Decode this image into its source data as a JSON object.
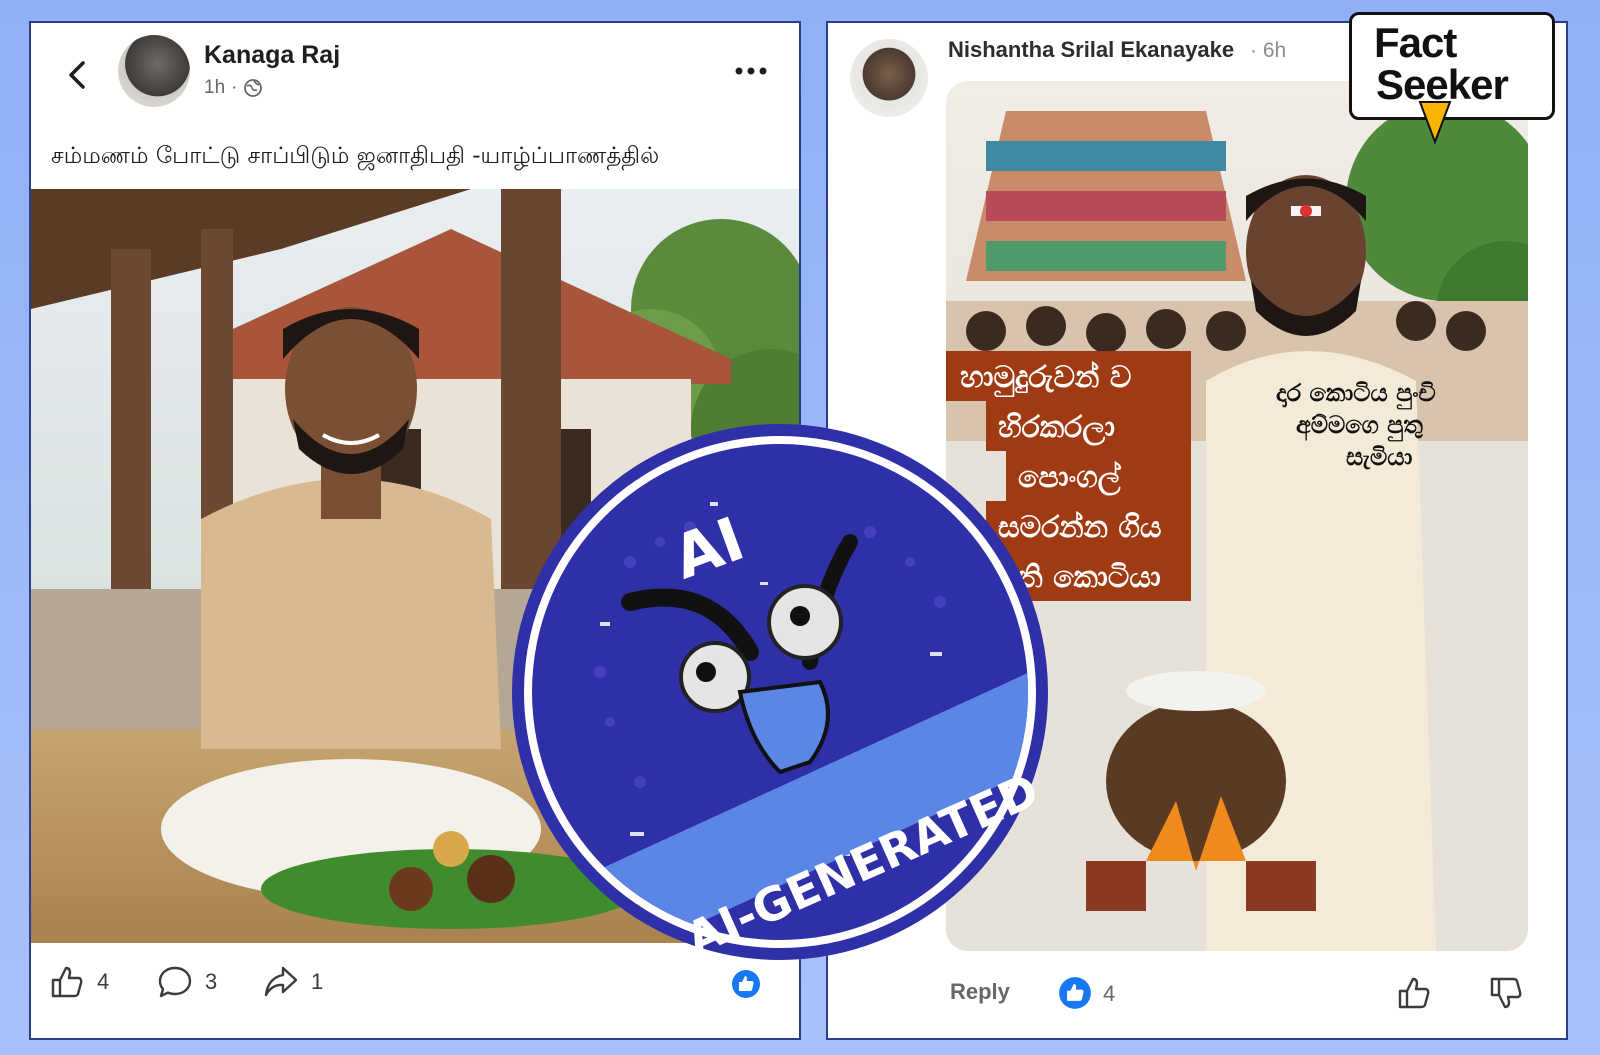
{
  "left_post": {
    "author": "Kanaga Raj",
    "time": "1h",
    "caption": "சம்மணம் போட்டு சாப்பிடும் ஜனாதிபதி -யாழ்ப்பாணத்தில்",
    "likes": "4",
    "comments": "3",
    "shares": "1"
  },
  "right_post": {
    "author": "Nishantha Srilal Ekanayake",
    "time": "· 6h",
    "meme_text_left": [
      "හාමුදුරුවන් ව",
      "හිරකරලා",
      "පොංගල්",
      "සමරන්න ගිය",
      "පති කොටියා"
    ],
    "meme_text_right": [
      "දාර කොටිය පුංචි",
      "අම්මගෙ පුතු",
      "සැමියා"
    ],
    "reply_label": "Reply",
    "reaction_count": "4"
  },
  "logo": {
    "line1": "Fact",
    "line2": "Seeker"
  },
  "stamp": {
    "top_text": "AI",
    "band_text": "AI-GENERATED"
  },
  "colors": {
    "stamp_blue": "#2f2fa8",
    "band_blue": "#5b86e5",
    "facebook_blue": "#1877f2",
    "banner_red": "#a03a12"
  }
}
